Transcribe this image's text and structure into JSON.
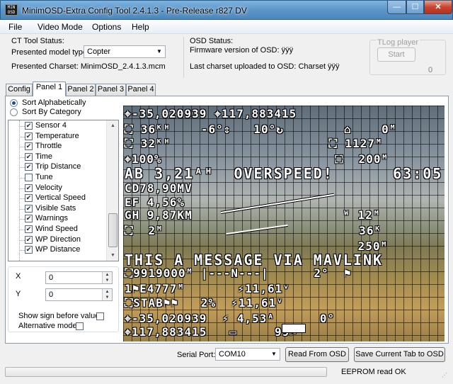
{
  "window": {
    "title": "MinimOSD-Extra Config Tool 2.4.1.3 - Pre-Release r827 DV",
    "icon_text": "MIN OSD"
  },
  "menu": [
    "File",
    "Video Mode",
    "Options",
    "Help"
  ],
  "ct_status": {
    "heading": "CT Tool Status:",
    "model_label": "Presented model type:",
    "model_value": "Copter",
    "charset_label": "Presented Charset: MinimOSD_2.4.1.3.mcm"
  },
  "osd_status": {
    "heading": "OSD Status:",
    "firmware": "Firmware version of OSD: ÿÿÿ",
    "charset": "Last charset uploaded to OSD: Charset ÿÿÿ"
  },
  "tlog": {
    "heading": "TLog player",
    "start_label": "Start",
    "counter": "0"
  },
  "tabs": [
    "Config",
    "Panel 1",
    "Panel 2",
    "Panel 3",
    "Panel 4"
  ],
  "active_tab": "Panel 1",
  "sort": {
    "alpha": "Sort Alphabetically",
    "category": "Sort By Category",
    "selected": "alpha"
  },
  "panel_items": [
    {
      "label": "Sensor 4",
      "checked": true
    },
    {
      "label": "Temperature",
      "checked": true
    },
    {
      "label": "Throttle",
      "checked": true
    },
    {
      "label": "Time",
      "checked": true
    },
    {
      "label": "Trip Distance",
      "checked": true
    },
    {
      "label": "Tune",
      "checked": false
    },
    {
      "label": "Velocity",
      "checked": true
    },
    {
      "label": "Vertical Speed",
      "checked": true
    },
    {
      "label": "Visible Sats",
      "checked": true
    },
    {
      "label": "Warnings",
      "checked": true
    },
    {
      "label": "Wind Speed",
      "checked": true
    },
    {
      "label": "WP Direction",
      "checked": true
    },
    {
      "label": "WP Distance",
      "checked": true
    }
  ],
  "position": {
    "x_label": "X",
    "x_value": "0",
    "y_label": "Y",
    "y_value": "0",
    "sign_label": "Show sign before value",
    "sign_checked": false,
    "alt_label": "Alternative mode",
    "alt_checked": false
  },
  "osd_lines": [
    {
      "text": "⌖-35,020939 ⌖117,883415"
    },
    {
      "text": "⛶ 36ᴷᴴ    -6°⇕   10°↻        ⌂    0ᴹ"
    },
    {
      "text": "⛶ 32ᴷᴴ                     ⛶ 1127ᴹ"
    },
    {
      "text": "⌖100%                       ⛶  200ᴹ"
    },
    {
      "text": "AB 3,21ᴬᴴ  OVERSPEED!      63:05"
    },
    {
      "text": "CD78,90MV"
    },
    {
      "text": "EF 4,56%"
    },
    {
      "text": "GH 9,87KM                    ᵂ 12ᴹ"
    },
    {
      "text": "⛶  2ᴹ                          36ᴷ"
    },
    {
      "text": "                               250ᴹ"
    },
    {
      "text": "THIS A MESSAGE VIA MAVLINK"
    },
    {
      "text": "⛶9919000ᴹ |---N---|      2°  ⚑"
    },
    {
      "text": "1⚑E4777ᴹ       ⚡11,61ᵛ"
    },
    {
      "text": "⛶STAB⚑⚑   2%  ⚡11,61ᵛ"
    },
    {
      "text": "⌖-35,020939  ⚡ 4,53ᴬ      0°"
    },
    {
      "text": "⌖117,883415   ▭     99⚑"
    }
  ],
  "serial": {
    "label": "Serial Port:",
    "value": "COM10"
  },
  "buttons": {
    "read": "Read From OSD",
    "save": "Save Current Tab to OSD"
  },
  "status": {
    "progress_percent": 0,
    "text": "EEPROM read OK"
  }
}
